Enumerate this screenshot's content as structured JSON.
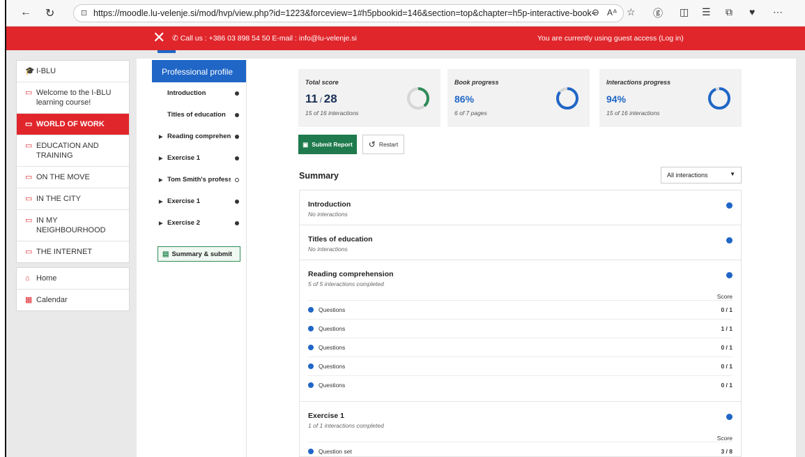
{
  "browser": {
    "url": "https://moodle.lu-velenje.si/mod/hvp/view.php?id=1223&forceview=1#h5pbookid=146&section=top&chapter=h5p-interactive-book-chapter-summ...",
    "icons": [
      "back-icon",
      "refresh-icon",
      "lock-icon",
      "zoom-icon",
      "read-aloud-icon",
      "favorite-icon",
      "extensions-icon",
      "split-icon",
      "favorites-icon",
      "collections-icon",
      "health-icon",
      "more-icon"
    ]
  },
  "topbar": {
    "close": "✕",
    "contact": "Call us : +386 03 898 54 50  E-mail : info@lu-velenje.si",
    "guest": "You are currently using guest access (Log in)"
  },
  "course_nav": {
    "items": [
      {
        "label": "I-BLU",
        "icon": "graduation-cap-icon"
      },
      {
        "label": "Welcome to the I-BLU learning course!",
        "icon": "folder-icon"
      },
      {
        "label": "WORLD OF WORK",
        "icon": "folder-icon",
        "active": true
      },
      {
        "label": "EDUCATION AND TRAINING",
        "icon": "folder-icon"
      },
      {
        "label": "ON THE MOVE",
        "icon": "folder-icon"
      },
      {
        "label": "IN THE CITY",
        "icon": "folder-icon"
      },
      {
        "label": "IN MY NEIGHBOURHOOD",
        "icon": "folder-icon"
      },
      {
        "label": "THE INTERNET",
        "icon": "folder-icon"
      }
    ],
    "home": "Home",
    "calendar": "Calendar"
  },
  "chapters": {
    "header": "Professional profile",
    "items": [
      {
        "label": "Introduction",
        "expandable": false,
        "done": true
      },
      {
        "label": "Titles of education",
        "expandable": false,
        "done": true
      },
      {
        "label": "Reading comprehen...",
        "expandable": true,
        "done": true
      },
      {
        "label": "Exercise 1",
        "expandable": true,
        "done": true
      },
      {
        "label": "Tom Smith's profess...",
        "expandable": true,
        "done": false
      },
      {
        "label": "Exercise 1",
        "expandable": true,
        "done": true
      },
      {
        "label": "Exercise 2",
        "expandable": true,
        "done": true
      }
    ],
    "summary_button": "Summary & submit"
  },
  "scores": {
    "total": {
      "label": "Total score",
      "value": "11",
      "sep": "/",
      "max": "28",
      "sub": "15 of 16 interactions",
      "progress": 0.39,
      "color": "#2e8b57"
    },
    "book": {
      "label": "Book progress",
      "value": "86%",
      "sub": "6 of 7 pages",
      "progress": 0.86,
      "color": "#1f66c6"
    },
    "interactions": {
      "label": "Interactions progress",
      "value": "94%",
      "sub": "15 of 16 interactions",
      "progress": 0.94,
      "color": "#1f66c6"
    }
  },
  "actions": {
    "submit": "Submit Report",
    "restart": "Restart"
  },
  "summary": {
    "title": "Summary",
    "filter": "All interactions",
    "score_label": "Score",
    "sections": [
      {
        "title": "Introduction",
        "subtitle": "No interactions"
      },
      {
        "title": "Titles of education",
        "subtitle": "No interactions"
      },
      {
        "title": "Reading comprehension",
        "subtitle": "5 of 5 interactions completed",
        "rows": [
          {
            "name": "Questions",
            "score": "0 / 1"
          },
          {
            "name": "Questions",
            "score": "1 / 1"
          },
          {
            "name": "Questions",
            "score": "0 / 1"
          },
          {
            "name": "Questions",
            "score": "0 / 1"
          },
          {
            "name": "Questions",
            "score": "0 / 1"
          }
        ]
      },
      {
        "title": "Exercise 1",
        "subtitle": "1 of 1 interactions completed",
        "rows": [
          {
            "name": "Question set",
            "score": "3 / 8"
          }
        ]
      }
    ]
  }
}
